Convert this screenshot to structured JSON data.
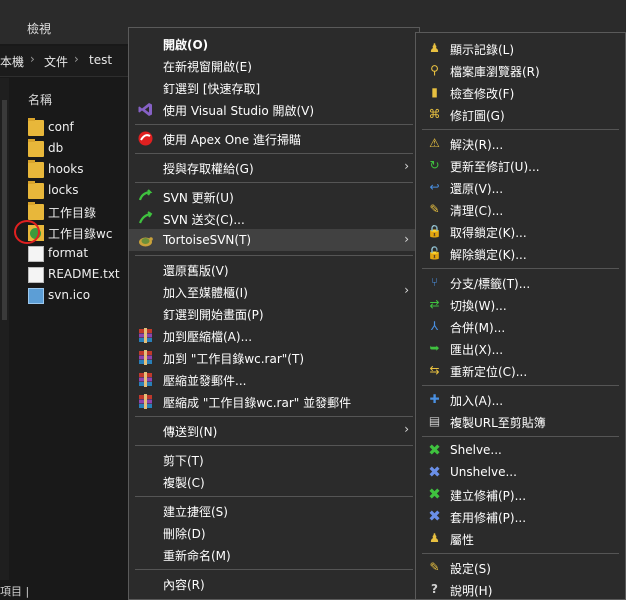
{
  "explorer": {
    "ribbon_tab": "檢視",
    "breadcrumb": [
      "本機",
      "文件",
      "test"
    ],
    "column_name": "名稱",
    "files": [
      {
        "name": "conf",
        "type": "folder"
      },
      {
        "name": "db",
        "type": "folder"
      },
      {
        "name": "hooks",
        "type": "folder"
      },
      {
        "name": "locks",
        "type": "folder"
      },
      {
        "name": "工作目錄",
        "type": "folder"
      },
      {
        "name": "工作目錄wc",
        "type": "svn-folder"
      },
      {
        "name": "format",
        "type": "file"
      },
      {
        "name": "README.txt",
        "type": "text-file"
      },
      {
        "name": "svn.ico",
        "type": "image"
      }
    ],
    "status_text": "項目 |"
  },
  "context_menu": {
    "items": [
      {
        "label": "開啟(O)",
        "icon": "",
        "bold": true
      },
      {
        "label": "在新視窗開啟(E)",
        "icon": ""
      },
      {
        "label": "釘選到 [快速存取]",
        "icon": ""
      },
      {
        "label": "使用 Visual Studio 開啟(V)",
        "icon": "visual-studio-icon"
      },
      {
        "label": "使用 Apex One 進行掃瞄",
        "icon": "apex-one-icon"
      },
      {
        "label": "授與存取權給(G)",
        "icon": "",
        "submenu": true
      },
      {
        "label": "SVN 更新(U)",
        "icon": "svn-update-icon"
      },
      {
        "label": "SVN 送交(C)...",
        "icon": "svn-commit-icon"
      },
      {
        "label": "TortoiseSVN(T)",
        "icon": "tortoisesvn-icon",
        "submenu": true,
        "highlighted": true
      },
      {
        "label": "還原舊版(V)",
        "icon": ""
      },
      {
        "label": "加入至媒體櫃(I)",
        "icon": "",
        "submenu": true
      },
      {
        "label": "釘選到開始畫面(P)",
        "icon": ""
      },
      {
        "label": "加到壓縮檔(A)...",
        "icon": "winrar-icon"
      },
      {
        "label": "加到 \"工作目錄wc.rar\"(T)",
        "icon": "winrar-icon"
      },
      {
        "label": "壓縮並發郵件...",
        "icon": "winrar-icon"
      },
      {
        "label": "壓縮成 \"工作目錄wc.rar\" 並發郵件",
        "icon": "winrar-icon"
      },
      {
        "label": "傳送到(N)",
        "icon": "",
        "submenu": true
      },
      {
        "label": "剪下(T)",
        "icon": ""
      },
      {
        "label": "複製(C)",
        "icon": ""
      },
      {
        "label": "建立捷徑(S)",
        "icon": ""
      },
      {
        "label": "刪除(D)",
        "icon": ""
      },
      {
        "label": "重新命名(M)",
        "icon": ""
      },
      {
        "label": "內容(R)",
        "icon": ""
      }
    ]
  },
  "tortoise_submenu": {
    "items": [
      {
        "label": "顯示記錄(L)",
        "icon": "show-log-icon"
      },
      {
        "label": "檔案庫瀏覽器(R)",
        "icon": "repo-browser-icon"
      },
      {
        "label": "檢查修改(F)",
        "icon": "check-modifications-icon"
      },
      {
        "label": "修訂圖(G)",
        "icon": "revision-graph-icon"
      },
      {
        "label": "解決(R)...",
        "icon": "resolve-icon"
      },
      {
        "label": "更新至修訂(U)...",
        "icon": "update-to-revision-icon"
      },
      {
        "label": "還原(V)...",
        "icon": "revert-icon"
      },
      {
        "label": "清理(C)...",
        "icon": "cleanup-icon"
      },
      {
        "label": "取得鎖定(K)...",
        "icon": "get-lock-icon"
      },
      {
        "label": "解除鎖定(K)...",
        "icon": "release-lock-icon"
      },
      {
        "label": "分支/標籤(T)...",
        "icon": "branch-tag-icon"
      },
      {
        "label": "切換(W)...",
        "icon": "switch-icon"
      },
      {
        "label": "合併(M)...",
        "icon": "merge-icon"
      },
      {
        "label": "匯出(X)...",
        "icon": "export-icon"
      },
      {
        "label": "重新定位(C)...",
        "icon": "relocate-icon"
      },
      {
        "label": "加入(A)...",
        "icon": "add-icon"
      },
      {
        "label": "複製URL至剪貼簿",
        "icon": "copy-url-icon"
      },
      {
        "label": "Shelve...",
        "icon": "shelve-icon"
      },
      {
        "label": "Unshelve...",
        "icon": "unshelve-icon"
      },
      {
        "label": "建立修補(P)...",
        "icon": "create-patch-icon"
      },
      {
        "label": "套用修補(P)...",
        "icon": "apply-patch-icon"
      },
      {
        "label": "屬性",
        "icon": "properties-icon"
      },
      {
        "label": "設定(S)",
        "icon": "settings-icon"
      },
      {
        "label": "說明(H)",
        "icon": "help-icon"
      }
    ]
  }
}
